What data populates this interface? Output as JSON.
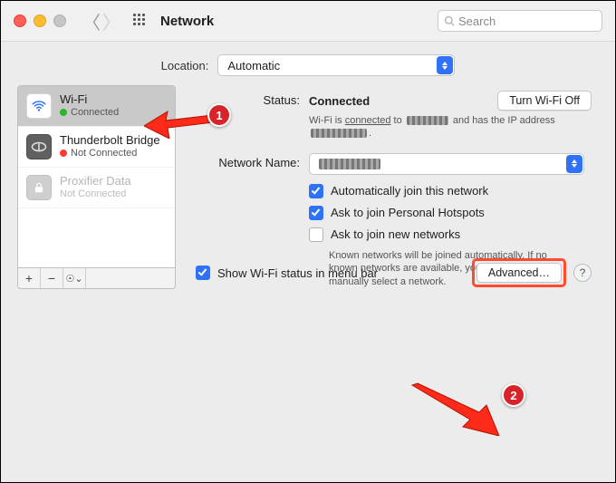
{
  "window": {
    "title": "Network"
  },
  "search": {
    "placeholder": "Search"
  },
  "location": {
    "label": "Location:",
    "value": "Automatic"
  },
  "sidebar": {
    "items": [
      {
        "name": "Wi-Fi",
        "status": "Connected",
        "dot": "green",
        "selected": true
      },
      {
        "name": "Thunderbolt Bridge",
        "status": "Not Connected",
        "dot": "red",
        "selected": false
      },
      {
        "name": "Proxifier Data",
        "status": "Not Connected",
        "dot": "",
        "selected": false,
        "dim": true
      }
    ],
    "footer": {
      "plus": "+",
      "minus": "−",
      "more": "☉⌄"
    }
  },
  "main": {
    "status_label": "Status:",
    "status_value": "Connected",
    "toggle_button": "Turn Wi-Fi Off",
    "status_sub_prefix": "Wi-Fi is ",
    "status_sub_link": "connected",
    "status_sub_mid": " to ",
    "status_sub_suffix": " and has the IP address ",
    "netname_label": "Network Name:",
    "netname_value": "",
    "auto_join": "Automatically join this network",
    "ask_hotspots": "Ask to join Personal Hotspots",
    "ask_new": "Ask to join new networks",
    "ask_new_help": "Known networks will be joined automatically. If no known networks are available, you will have to manually select a network.",
    "show_menubar": "Show Wi-Fi status in menu bar",
    "advanced": "Advanced…",
    "help": "?"
  },
  "callouts": {
    "one": "1",
    "two": "2"
  }
}
